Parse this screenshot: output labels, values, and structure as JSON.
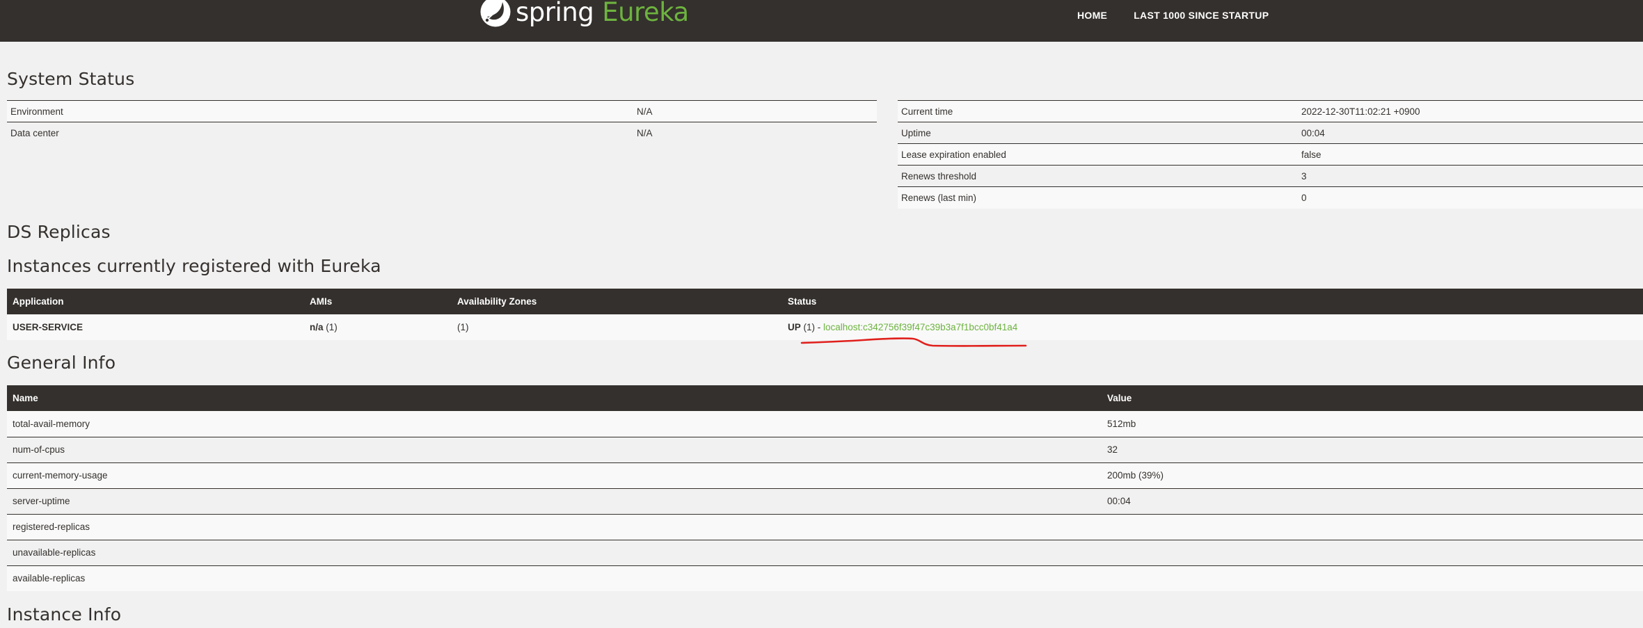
{
  "header": {
    "brand_spring": "spring",
    "brand_eureka": "Eureka",
    "nav": [
      "HOME",
      "LAST 1000 SINCE STARTUP"
    ]
  },
  "system_status": {
    "title": "System Status",
    "left": [
      {
        "key": "Environment",
        "value": "N/A"
      },
      {
        "key": "Data center",
        "value": "N/A"
      }
    ],
    "right": [
      {
        "key": "Current time",
        "value": "2022-12-30T11:02:21 +0900"
      },
      {
        "key": "Uptime",
        "value": "00:04"
      },
      {
        "key": "Lease expiration enabled",
        "value": "false"
      },
      {
        "key": "Renews threshold",
        "value": "3"
      },
      {
        "key": "Renews (last min)",
        "value": "0"
      }
    ]
  },
  "ds_replicas": {
    "title": "DS Replicas"
  },
  "instances": {
    "title": "Instances currently registered with Eureka",
    "columns": [
      "Application",
      "AMIs",
      "Availability Zones",
      "Status"
    ],
    "rows": [
      {
        "application": "USER-SERVICE",
        "amis_bold": "n/a",
        "amis_count": " (1)",
        "zones": "(1)",
        "status_bold": "UP",
        "status_rest": " (1) - ",
        "instance_link": "localhost:c342756f39f47c39b3a7f1bcc0bf41a4"
      }
    ]
  },
  "general_info": {
    "title": "General Info",
    "columns": [
      "Name",
      "Value"
    ],
    "rows": [
      {
        "name": "total-avail-memory",
        "value": "512mb"
      },
      {
        "name": "num-of-cpus",
        "value": "32"
      },
      {
        "name": "current-memory-usage",
        "value": "200mb (39%)"
      },
      {
        "name": "server-uptime",
        "value": "00:04"
      },
      {
        "name": "registered-replicas",
        "value": ""
      },
      {
        "name": "unavailable-replicas",
        "value": ""
      },
      {
        "name": "available-replicas",
        "value": ""
      }
    ]
  },
  "instance_info": {
    "title": "Instance Info"
  },
  "colors": {
    "nav_bg": "#34302d",
    "accent_green": "#6db33f",
    "annotation_red": "#e0201c"
  }
}
